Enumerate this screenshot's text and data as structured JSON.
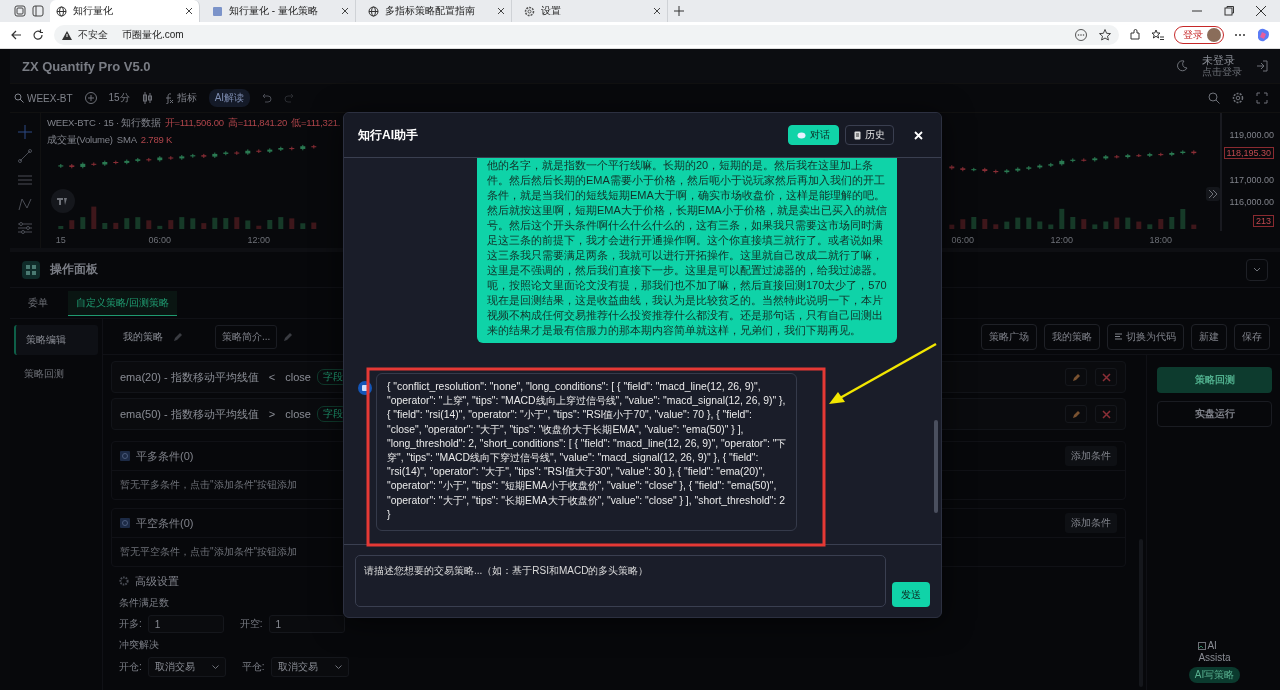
{
  "browser": {
    "tabs": [
      {
        "title": "知行量化",
        "selected": true
      },
      {
        "title": "知行量化 - 量化策略",
        "selected": false
      },
      {
        "title": "多指标策略配置指南",
        "selected": false
      },
      {
        "title": "设置",
        "selected": false
      }
    ],
    "address": {
      "security": "不安全",
      "url": "币圈量化.com"
    },
    "login_button": "登录"
  },
  "app": {
    "title": "ZX Quantify Pro V5.0",
    "user_status": "未登录",
    "user_hint": "点击登录"
  },
  "toolbar": {
    "symbol": "WEEX-BT",
    "interval": "15分",
    "indicators": "指标",
    "ai_button": "AI解读"
  },
  "chart": {
    "legend_title": "WEEX-BTC · 15 · 知行数据",
    "open": "开=111,506.00",
    "high": "高=111,841.20",
    "low": "低=111,321.",
    "volume_label": "成交量(Volume)",
    "volume_ma": "SMA",
    "volume_value": "2.789 K",
    "last_price": "118,195.30",
    "last_volume": "213",
    "chart_data": {
      "type": "candlestick",
      "ylim": [
        114733,
        119978
      ],
      "categories": [
        "15",
        null,
        null,
        null,
        null,
        null,
        null,
        null,
        null,
        "06:00",
        null,
        null,
        null,
        null,
        null,
        null,
        null,
        null,
        "12:00",
        null,
        null,
        null,
        null,
        null,
        null,
        null,
        null,
        null,
        null,
        null,
        null,
        null,
        null,
        null,
        null,
        null,
        null,
        null,
        null,
        null,
        null,
        null,
        null,
        null,
        null,
        null,
        null,
        null,
        null,
        null,
        null,
        null,
        null,
        null,
        null,
        null,
        null,
        null,
        null,
        null,
        null,
        null,
        null,
        null,
        null,
        null,
        null,
        null,
        null,
        null,
        null,
        null,
        null,
        null,
        null,
        null,
        null,
        null,
        null,
        null,
        null,
        null,
        "06:00",
        null,
        null,
        null,
        null,
        null,
        null,
        null,
        null,
        "12:00",
        null,
        null,
        null,
        null,
        null,
        null,
        null,
        null,
        "18:00",
        null,
        null,
        null
      ],
      "yticks": [
        {
          "value": 119000,
          "label": "119,000.00"
        },
        {
          "value": 117000,
          "label": "117,000.00"
        },
        {
          "value": 116000,
          "label": "116,000.00"
        }
      ],
      "ohlc": [
        [
          117600,
          117710,
          117540,
          117650
        ],
        [
          117650,
          117710,
          117520,
          117580
        ],
        [
          117580,
          117780,
          117520,
          117720
        ],
        [
          117720,
          117780,
          117630,
          117690
        ],
        [
          117690,
          117860,
          117630,
          117800
        ],
        [
          117800,
          117860,
          117700,
          117760
        ],
        [
          117760,
          117910,
          117700,
          117850
        ],
        [
          117850,
          117980,
          117790,
          117920
        ],
        [
          117920,
          117980,
          117820,
          117880
        ],
        [
          117880,
          118060,
          117820,
          118000
        ],
        [
          118000,
          118060,
          117900,
          117960
        ],
        [
          117960,
          118110,
          117900,
          118050
        ],
        [
          118050,
          118160,
          117990,
          118100
        ],
        [
          118100,
          118160,
          117980,
          118040
        ],
        [
          118040,
          118220,
          117980,
          118160
        ],
        [
          118160,
          118280,
          118100,
          118220
        ],
        [
          118220,
          118280,
          118120,
          118180
        ],
        [
          118180,
          118360,
          118120,
          118300
        ],
        [
          118300,
          118360,
          118200,
          118260
        ],
        [
          118260,
          118410,
          118200,
          118350
        ],
        [
          118350,
          118480,
          118290,
          118420
        ],
        [
          118420,
          118480,
          118320,
          118380
        ],
        [
          118380,
          118560,
          118320,
          118500
        ],
        [
          118500,
          118560,
          118400,
          118460
        ],
        null,
        null,
        null,
        null,
        null,
        null,
        null,
        null,
        null,
        null,
        null,
        null,
        null,
        null,
        null,
        null,
        null,
        null,
        null,
        null,
        null,
        null,
        null,
        null,
        null,
        null,
        null,
        null,
        null,
        null,
        null,
        null,
        null,
        null,
        null,
        null,
        null,
        null,
        null,
        null,
        null,
        null,
        null,
        null,
        null,
        null,
        null,
        null,
        null,
        null,
        null,
        null,
        null,
        null,
        null,
        null,
        null,
        [
          117600,
          117660,
          117460,
          117520
        ],
        [
          117520,
          117580,
          117390,
          117450
        ],
        [
          117450,
          117540,
          117390,
          117480
        ],
        [
          117480,
          117540,
          117340,
          117400
        ],
        [
          117400,
          117460,
          117290,
          117350
        ],
        [
          117350,
          117480,
          117290,
          117420
        ],
        [
          117420,
          117560,
          117360,
          117500
        ],
        [
          117500,
          117620,
          117440,
          117560
        ],
        [
          117560,
          117700,
          117500,
          117640
        ],
        [
          117640,
          117760,
          117580,
          117700
        ],
        [
          117700,
          117910,
          117640,
          117850
        ],
        [
          117850,
          117960,
          117790,
          117900
        ],
        [
          117900,
          117960,
          117820,
          117880
        ],
        [
          117880,
          118020,
          117820,
          117960
        ],
        [
          117960,
          118110,
          117900,
          118050
        ],
        [
          118050,
          118110,
          117960,
          118020
        ],
        [
          118020,
          118160,
          117960,
          118100
        ],
        [
          118100,
          118160,
          118020,
          118080
        ],
        [
          118080,
          118210,
          118020,
          118150
        ],
        [
          118150,
          118210,
          118060,
          118120
        ],
        [
          118120,
          118260,
          118060,
          118200
        ],
        [
          118200,
          118320,
          118140,
          118260
        ],
        [
          118260,
          118320,
          118135,
          118195
        ]
      ]
    }
  },
  "panel": {
    "title": "操作面板",
    "tabs": [
      {
        "label": "委单",
        "selected": false
      },
      {
        "label": "自定义策略/回测策略",
        "selected": true
      }
    ],
    "side_nav": [
      {
        "label": "策略编辑",
        "selected": true
      },
      {
        "label": "策略回测",
        "selected": false
      }
    ],
    "strategy_name": "我的策略",
    "strategy_intro": "策略简介...",
    "actions": [
      "策略广场",
      "我的策略",
      "切换为代码",
      "新建",
      "保存"
    ],
    "conditions": [
      {
        "field": "ema(20) - 指数移动平均线值",
        "operator": "<",
        "value": "close",
        "tag": "字段"
      },
      {
        "field": "ema(50) - 指数移动平均线值",
        "operator": ">",
        "value": "close",
        "tag": "字段"
      }
    ],
    "sections": [
      {
        "title": "平多条件(0)",
        "empty": "暂无平多条件，点击\"添加条件\"按钮添加",
        "button": "添加条件"
      },
      {
        "title": "平空条件(0)",
        "empty": "暂无平空条件，点击\"添加条件\"按钮添加",
        "button": "添加条件"
      }
    ],
    "advanced": {
      "title": "高级设置",
      "threshold_label": "条件满足数",
      "long_label": "开多:",
      "long_value": "1",
      "short_label": "开空:",
      "short_value": "1",
      "conflict_label": "冲突解决",
      "open_label": "开仓:",
      "open_value": "取消交易",
      "close_label": "平仓:",
      "close_value": "取消交易"
    },
    "run_buttons": [
      {
        "label": "策略回测",
        "kind": "primary"
      },
      {
        "label": "实盘运行",
        "kind": "outline"
      }
    ],
    "assistant": {
      "alt_line1": "AI",
      "alt_line2": "Assista",
      "badge": "AI写策略"
    }
  },
  "modal": {
    "title": "知行AI助手",
    "tabs": [
      {
        "label": "对话",
        "selected": true
      },
      {
        "label": "历史",
        "selected": false
      }
    ],
    "messages": [
      {
        "kind": "user",
        "text": "他的名字，就是指数一个平行线嘛。长期的20，短期的是。然后我在这里加上条件。然后然后长期的EMA需要小于价格，然后呃小于说玩家然后再加入我们的开工条件，就是当我们的短线短期EMA大于啊，确实市场收盘价，这样是能理解的吧。然后就按这里啊，短期EMA大于价格，长期EMA小于价格，就是卖出已买入的就信号。然后这个开头条件啊什么什么什么的，这有三条，如果我只需要这市场同时满足这三条的前提下，我才会进行开通操作啊。这个你直接填三就行了。或者说如果这三条我只需要满足两条，我就可以进行开拓操作。这里就自己改成二就行了嘛，这里是不强调的，然后我们直接下一步。这里是可以配置过滤器的，给我过滤器。呃，按照论文里面论文没有提，那我们也不加了嘛，然后直接回测170太少了，570现在是回测结果，这是收益曲线，我认为是比较贫乏的。当然特此说明一下，本片视频不构成任何交易推荐什么投资推荐什么都没有。还是那句话，只有自己回测出来的结果才是最有信服力的那本期内容简单就这样，兄弟们，我们下期再见。"
      },
      {
        "kind": "bot",
        "text": "{ \"conflict_resolution\": \"none\", \"long_conditions\": [ { \"field\": \"macd_line(12, 26, 9)\", \"operator\": \"上穿\", \"tips\": \"MACD线向上穿过信号线\", \"value\": \"macd_signal(12, 26, 9)\" }, { \"field\": \"rsi(14)\", \"operator\": \"小于\", \"tips\": \"RSI值小于70\", \"value\": 70 }, { \"field\": \"close\", \"operator\": \"大于\", \"tips\": \"收盘价大于长期EMA\", \"value\": \"ema(50)\" } ], \"long_threshold\": 2, \"short_conditions\": [ { \"field\": \"macd_line(12, 26, 9)\", \"operator\": \"下穿\", \"tips\": \"MACD线向下穿过信号线\", \"value\": \"macd_signal(12, 26, 9)\" }, { \"field\": \"rsi(14)\", \"operator\": \"大于\", \"tips\": \"RSI值大于30\", \"value\": 30 }, { \"field\": \"ema(20)\", \"operator\": \"小于\", \"tips\": \"短期EMA小于收盘价\", \"value\": \"close\" }, { \"field\": \"ema(50)\", \"operator\": \"大于\", \"tips\": \"长期EMA大于收盘价\", \"value\": \"close\" } ], \"short_threshold\": 2 }"
      }
    ],
    "input": {
      "placeholder": "请描述您想要的交易策略...（如：基于RSI和MACD的多头策略）"
    },
    "send_button": "发送"
  }
}
